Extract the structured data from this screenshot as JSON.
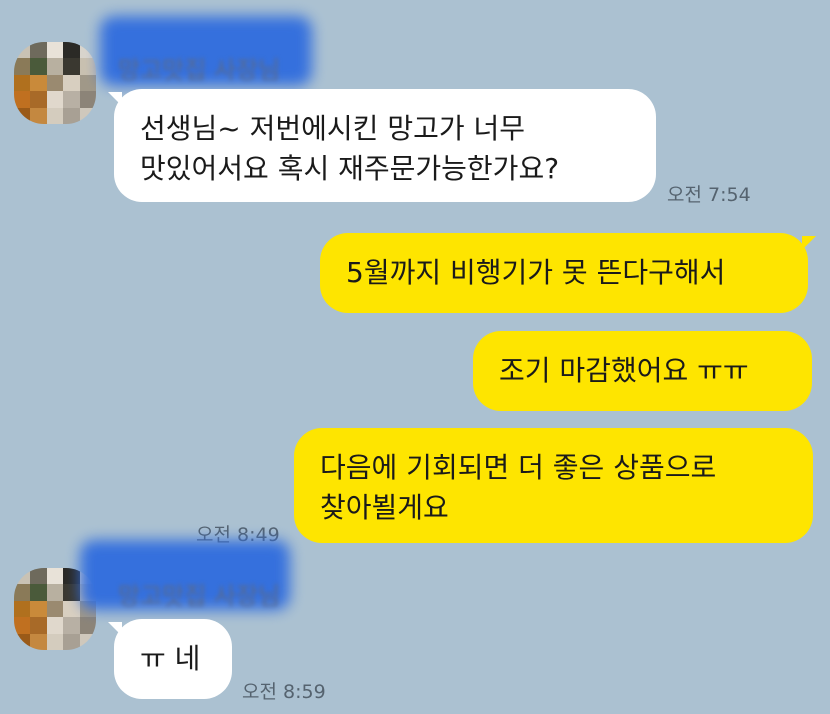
{
  "colors": {
    "background": "#abc1d1",
    "incoming_bubble": "#ffffff",
    "outgoing_bubble": "#fee500",
    "name_redaction": "#2f6cde"
  },
  "messages": [
    {
      "direction": "incoming",
      "sender_name": "망고맛집 사장님",
      "avatar": "pixelated-avatar",
      "lines": [
        "선생님~ 저번에시킨 망고가 너무",
        "맛있어서요 혹시 재주문가능한가요?"
      ],
      "time": "오전 7:54"
    },
    {
      "direction": "outgoing",
      "lines": [
        "5월까지 비행기가 못 뜬다구해서"
      ]
    },
    {
      "direction": "outgoing",
      "lines": [
        "조기 마감했어요 ㅠㅠ"
      ]
    },
    {
      "direction": "outgoing",
      "lines": [
        "다음에 기회되면 더 좋은 상품으로",
        "찾아뵐게요"
      ],
      "time": "오전 8:49"
    },
    {
      "direction": "incoming",
      "sender_name": "망고맛집 사장님",
      "avatar": "pixelated-avatar",
      "lines": [
        "ㅠ 네"
      ],
      "time": "오전 8:59"
    }
  ]
}
